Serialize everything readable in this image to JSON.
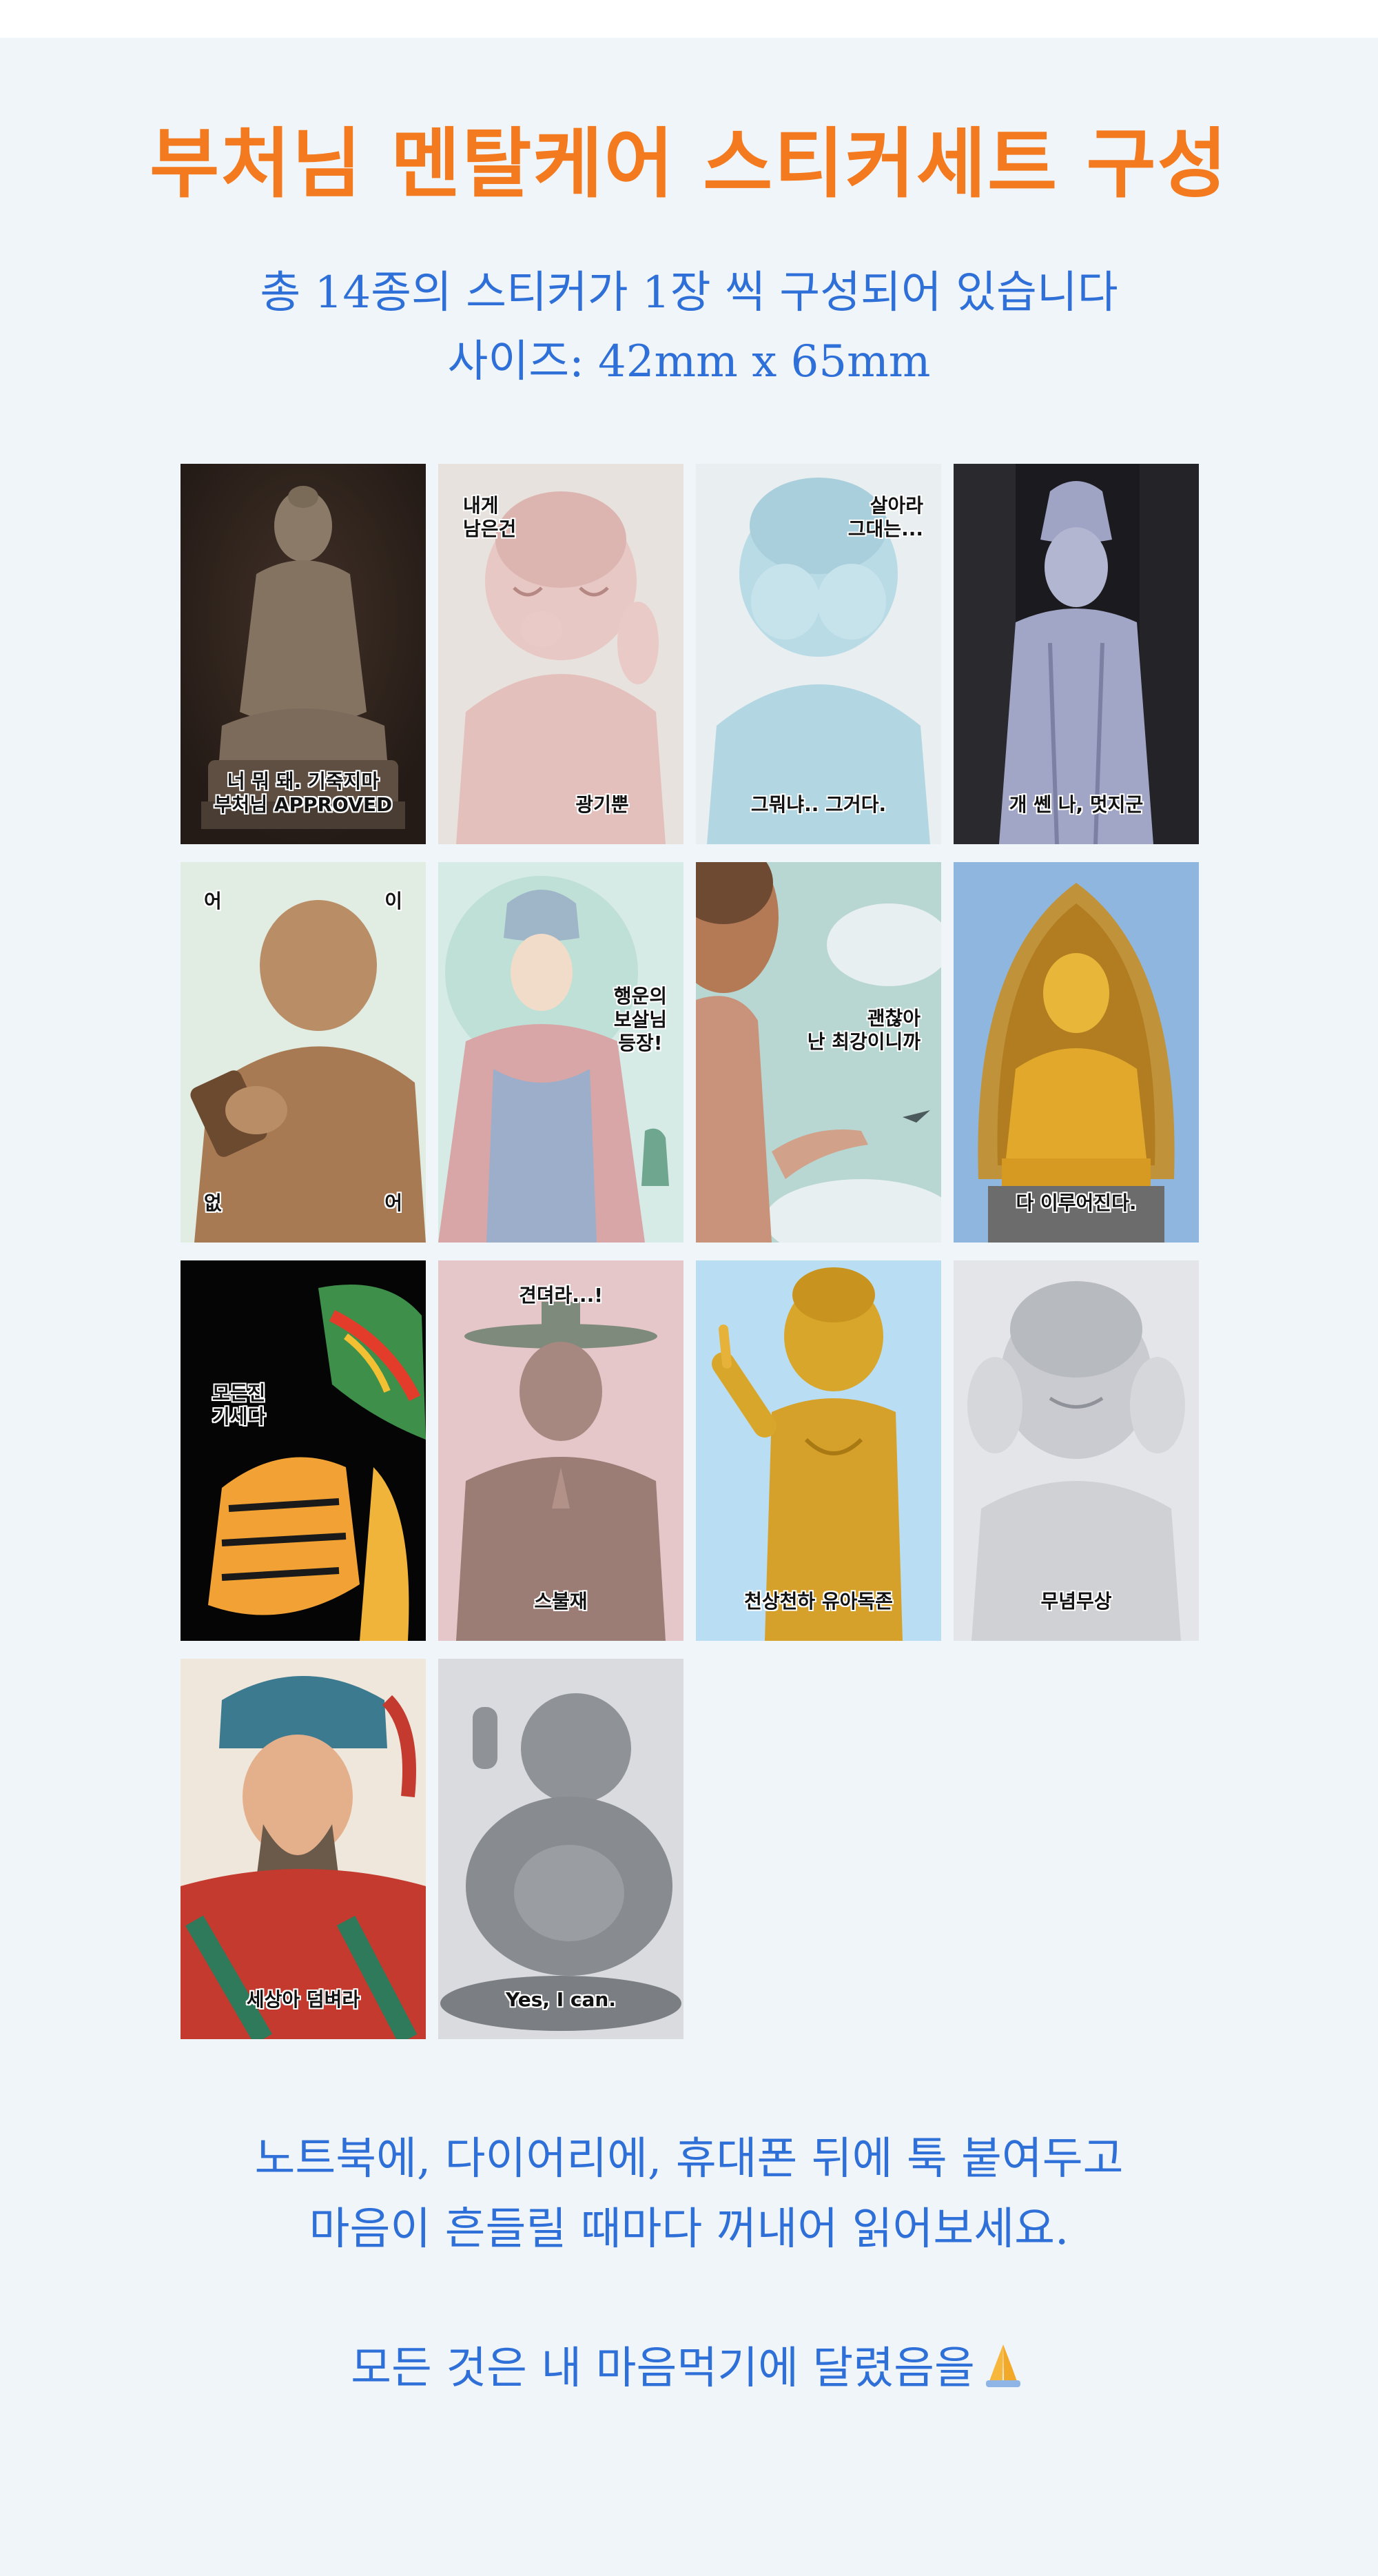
{
  "header": {
    "title": "부처님 멘탈케어 스티커세트 구성",
    "subtitle_line1": "총 14종의 스티커가 1장 씩 구성되어 있습니다",
    "subtitle_line2": "사이즈: 42mm x 65mm"
  },
  "stickers": [
    {
      "caption": "너 뭐 돼. 기죽지마\n부처님 APPROVED"
    },
    {
      "caption_top": "내게\n남은건",
      "caption": "광기뿐"
    },
    {
      "caption_top": "살아라\n그대는...",
      "caption": "그뭐냐.. 그거다."
    },
    {
      "caption": "개 쎈 나, 멋지군"
    },
    {
      "corner_tl": "어",
      "corner_tr": "이",
      "corner_bl": "없",
      "corner_br": "어"
    },
    {
      "caption_mid": "행운의\n보살님\n등장!"
    },
    {
      "caption_mid": "괜찮아\n난 최강이니까"
    },
    {
      "caption": "다 이루어진다."
    },
    {
      "caption_mid": "모든진\n기세다"
    },
    {
      "caption_top": "견뎌라...!",
      "caption": "스불재"
    },
    {
      "caption": "천상천하 유아독존"
    },
    {
      "caption": "무념무상"
    },
    {
      "caption": "세상아 덤벼라"
    },
    {
      "caption": "Yes, I can."
    }
  ],
  "footer": {
    "line1": "노트북에, 다이어리에, 휴대폰 뒤에 툭 붙여두고",
    "line2": "마음이 흔들릴 때마다 꺼내어 읽어보세요.",
    "line3": "모든 것은 내 마음먹기에 달렸음을",
    "emoji_icon": "folded-hands-icon"
  },
  "colors": {
    "title": "#f47a1f",
    "text": "#2e6fd8",
    "background": "#f0f5f9"
  }
}
